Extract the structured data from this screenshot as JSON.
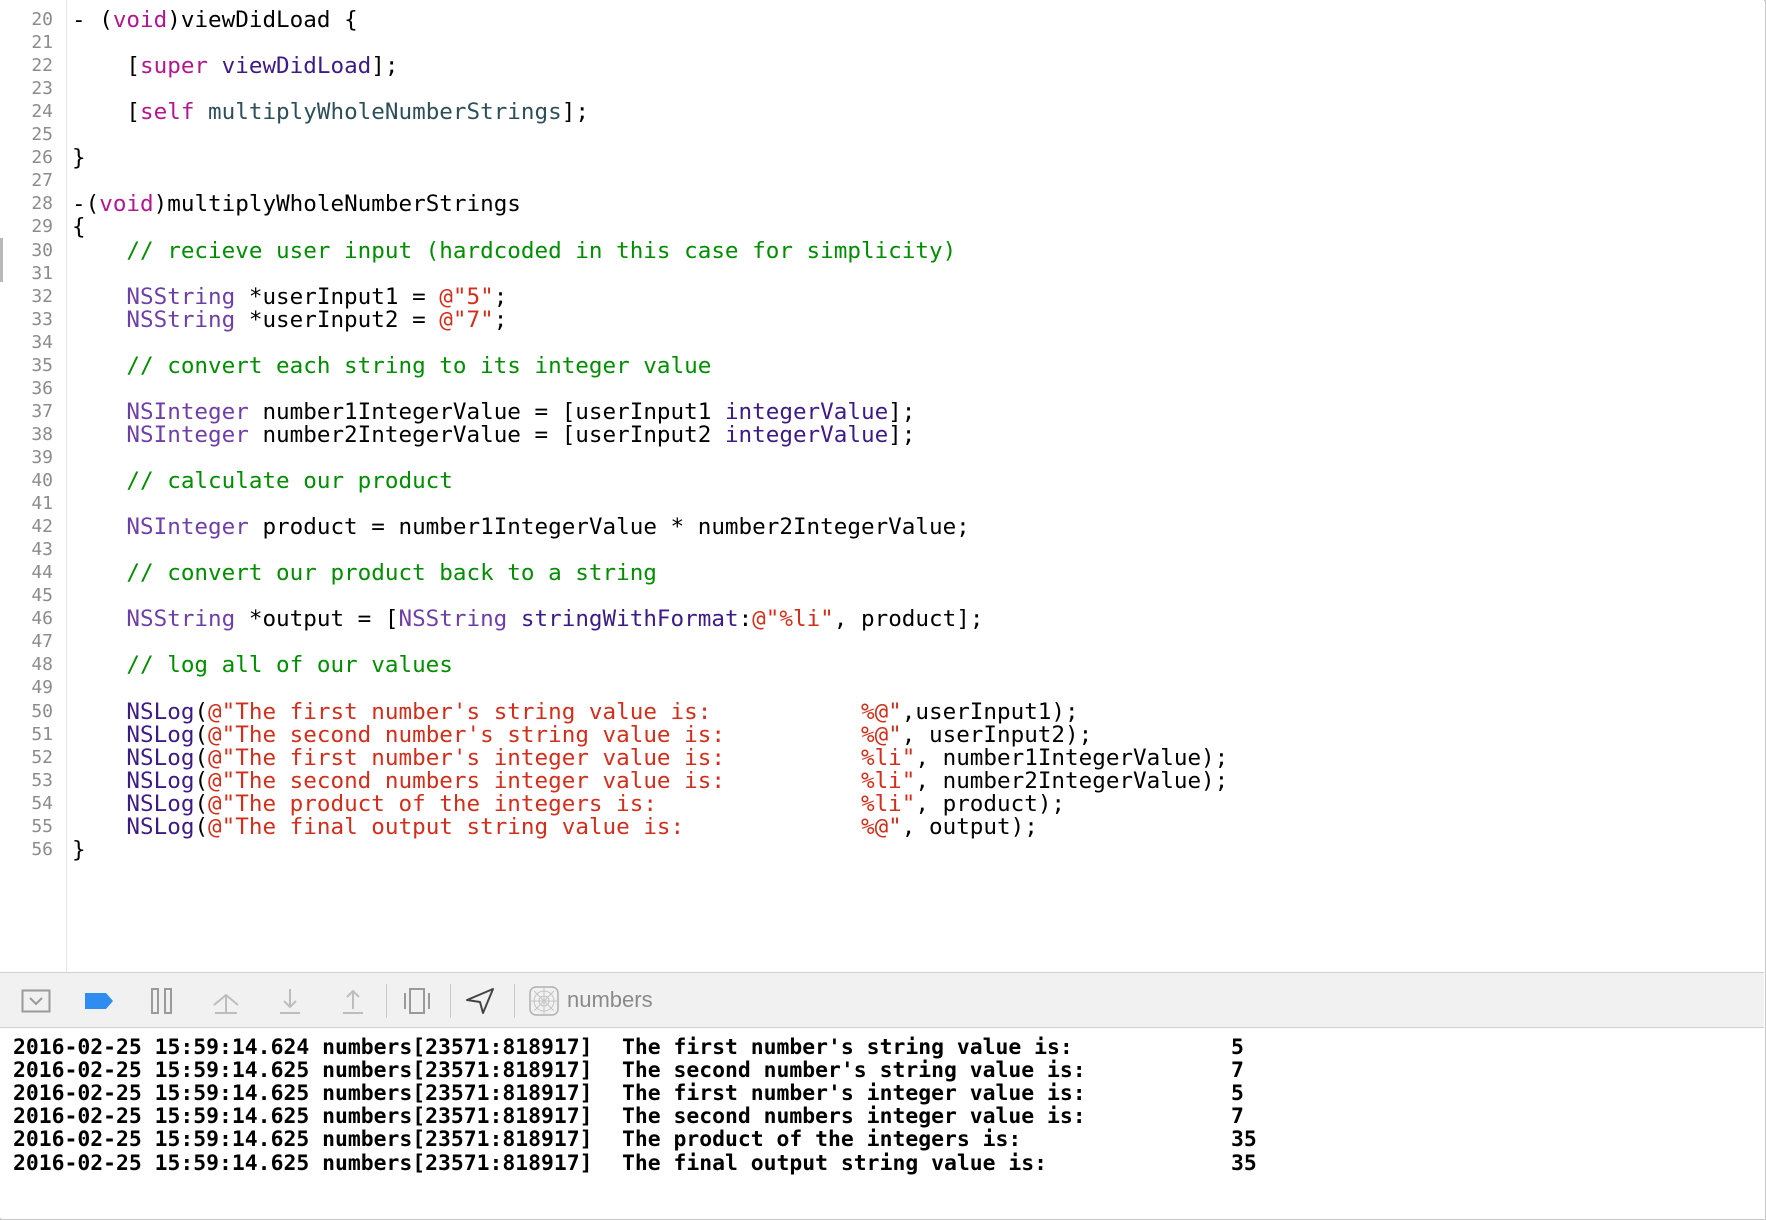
{
  "editor": {
    "lines": [
      {
        "number": "20",
        "tokens": [
          {
            "t": "- (",
            "c": "plain"
          },
          {
            "t": "void",
            "c": "keyword"
          },
          {
            "t": ")viewDidLoad {",
            "c": "plain"
          }
        ]
      },
      {
        "number": "21",
        "tokens": []
      },
      {
        "number": "22",
        "tokens": [
          {
            "t": "    [",
            "c": "plain"
          },
          {
            "t": "super",
            "c": "keyword"
          },
          {
            "t": " ",
            "c": "plain"
          },
          {
            "t": "viewDidLoad",
            "c": "method"
          },
          {
            "t": "];",
            "c": "plain"
          }
        ]
      },
      {
        "number": "23",
        "tokens": []
      },
      {
        "number": "24",
        "tokens": [
          {
            "t": "    [",
            "c": "plain"
          },
          {
            "t": "self",
            "c": "keyword"
          },
          {
            "t": " ",
            "c": "plain"
          },
          {
            "t": "multiplyWholeNumberStrings",
            "c": "member"
          },
          {
            "t": "];",
            "c": "plain"
          }
        ]
      },
      {
        "number": "25",
        "tokens": []
      },
      {
        "number": "26",
        "tokens": [
          {
            "t": "}",
            "c": "plain"
          }
        ]
      },
      {
        "number": "27",
        "tokens": []
      },
      {
        "number": "28",
        "tokens": [
          {
            "t": "-(",
            "c": "plain"
          },
          {
            "t": "void",
            "c": "keyword"
          },
          {
            "t": ")multiplyWholeNumberStrings",
            "c": "plain"
          }
        ]
      },
      {
        "number": "29",
        "tokens": [
          {
            "t": "{",
            "c": "plain"
          }
        ]
      },
      {
        "number": "30",
        "tokens": [
          {
            "t": "    // recieve user input (hardcoded in this case for simplicity)",
            "c": "comment"
          }
        ]
      },
      {
        "number": "31",
        "tokens": []
      },
      {
        "number": "32",
        "tokens": [
          {
            "t": "    NSString",
            "c": "type"
          },
          {
            "t": " *userInput1 = ",
            "c": "plain"
          },
          {
            "t": "@\"5\"",
            "c": "string"
          },
          {
            "t": ";",
            "c": "plain"
          }
        ]
      },
      {
        "number": "33",
        "tokens": [
          {
            "t": "    NSString",
            "c": "type"
          },
          {
            "t": " *userInput2 = ",
            "c": "plain"
          },
          {
            "t": "@\"7\"",
            "c": "string"
          },
          {
            "t": ";",
            "c": "plain"
          }
        ]
      },
      {
        "number": "34",
        "tokens": []
      },
      {
        "number": "35",
        "tokens": [
          {
            "t": "    // convert each string to its integer value",
            "c": "comment"
          }
        ]
      },
      {
        "number": "36",
        "tokens": []
      },
      {
        "number": "37",
        "tokens": [
          {
            "t": "    NSInteger",
            "c": "type"
          },
          {
            "t": " number1IntegerValue = [userInput1 ",
            "c": "plain"
          },
          {
            "t": "integerValue",
            "c": "method"
          },
          {
            "t": "];",
            "c": "plain"
          }
        ]
      },
      {
        "number": "38",
        "tokens": [
          {
            "t": "    NSInteger",
            "c": "type"
          },
          {
            "t": " number2IntegerValue = [userInput2 ",
            "c": "plain"
          },
          {
            "t": "integerValue",
            "c": "method"
          },
          {
            "t": "];",
            "c": "plain"
          }
        ]
      },
      {
        "number": "39",
        "tokens": []
      },
      {
        "number": "40",
        "tokens": [
          {
            "t": "    // calculate our product",
            "c": "comment"
          }
        ]
      },
      {
        "number": "41",
        "tokens": []
      },
      {
        "number": "42",
        "tokens": [
          {
            "t": "    NSInteger",
            "c": "type"
          },
          {
            "t": " product = number1IntegerValue * number2IntegerValue;",
            "c": "plain"
          }
        ]
      },
      {
        "number": "43",
        "tokens": []
      },
      {
        "number": "44",
        "tokens": [
          {
            "t": "    // convert our product back to a string",
            "c": "comment"
          }
        ]
      },
      {
        "number": "45",
        "tokens": []
      },
      {
        "number": "46",
        "tokens": [
          {
            "t": "    NSString",
            "c": "type"
          },
          {
            "t": " *output = [",
            "c": "plain"
          },
          {
            "t": "NSString",
            "c": "type"
          },
          {
            "t": " ",
            "c": "plain"
          },
          {
            "t": "stringWithFormat",
            "c": "method"
          },
          {
            "t": ":",
            "c": "plain"
          },
          {
            "t": "@\"%li\"",
            "c": "string"
          },
          {
            "t": ", product];",
            "c": "plain"
          }
        ]
      },
      {
        "number": "47",
        "tokens": []
      },
      {
        "number": "48",
        "tokens": [
          {
            "t": "    // log all of our values",
            "c": "comment"
          }
        ]
      },
      {
        "number": "49",
        "tokens": []
      },
      {
        "number": "50",
        "tokens": [
          {
            "t": "    NSLog",
            "c": "method"
          },
          {
            "t": "(",
            "c": "plain"
          },
          {
            "t": "@\"The first number's string value is:           %@\"",
            "c": "string"
          },
          {
            "t": ",userInput1);",
            "c": "plain"
          }
        ]
      },
      {
        "number": "51",
        "tokens": [
          {
            "t": "    NSLog",
            "c": "method"
          },
          {
            "t": "(",
            "c": "plain"
          },
          {
            "t": "@\"The second number's string value is:          %@\"",
            "c": "string"
          },
          {
            "t": ", userInput2);",
            "c": "plain"
          }
        ]
      },
      {
        "number": "52",
        "tokens": [
          {
            "t": "    NSLog",
            "c": "method"
          },
          {
            "t": "(",
            "c": "plain"
          },
          {
            "t": "@\"The first number's integer value is:          %li\"",
            "c": "string"
          },
          {
            "t": ", number1IntegerValue);",
            "c": "plain"
          }
        ]
      },
      {
        "number": "53",
        "tokens": [
          {
            "t": "    NSLog",
            "c": "method"
          },
          {
            "t": "(",
            "c": "plain"
          },
          {
            "t": "@\"The second numbers integer value is:          %li\"",
            "c": "string"
          },
          {
            "t": ", number2IntegerValue);",
            "c": "plain"
          }
        ]
      },
      {
        "number": "54",
        "tokens": [
          {
            "t": "    NSLog",
            "c": "method"
          },
          {
            "t": "(",
            "c": "plain"
          },
          {
            "t": "@\"The product of the integers is:               %li\"",
            "c": "string"
          },
          {
            "t": ", product);",
            "c": "plain"
          }
        ]
      },
      {
        "number": "55",
        "tokens": [
          {
            "t": "    NSLog",
            "c": "method"
          },
          {
            "t": "(",
            "c": "plain"
          },
          {
            "t": "@\"The final output string value is:             %@\"",
            "c": "string"
          },
          {
            "t": ", output);",
            "c": "plain"
          }
        ]
      },
      {
        "number": "56",
        "tokens": [
          {
            "t": "}",
            "c": "plain"
          }
        ]
      }
    ]
  },
  "debug_bar": {
    "buttons": [
      {
        "name": "hide-debug-area-button",
        "icon": "hide-debug-area-icon"
      },
      {
        "name": "breakpoints-toggle-button",
        "icon": "breakpoint-icon"
      },
      {
        "name": "pause-continue-button",
        "icon": "pause-icon"
      },
      {
        "name": "step-over-button",
        "icon": "step-over-icon"
      },
      {
        "name": "step-into-button",
        "icon": "step-into-icon"
      },
      {
        "name": "step-out-button",
        "icon": "step-out-icon"
      },
      {
        "name": "debug-view-hierarchy-button",
        "icon": "view-hierarchy-icon"
      },
      {
        "name": "simulate-location-button",
        "icon": "location-arrow-icon"
      }
    ],
    "target_icon": "app-target-icon",
    "target_name": "numbers",
    "colors": {
      "breakpoint_active": "#2f8cf0",
      "icon": "#9a9a9a"
    }
  },
  "console": {
    "lines": [
      {
        "prefix": "2016-02-25 15:59:14.624 numbers[23571:818917]",
        "message": "The first number's string value is:",
        "value": "5"
      },
      {
        "prefix": "2016-02-25 15:59:14.625 numbers[23571:818917]",
        "message": "The second number's string value is:",
        "value": "7"
      },
      {
        "prefix": "2016-02-25 15:59:14.625 numbers[23571:818917]",
        "message": "The first number's integer value is:",
        "value": "5"
      },
      {
        "prefix": "2016-02-25 15:59:14.625 numbers[23571:818917]",
        "message": "The second numbers integer value is:",
        "value": "7"
      },
      {
        "prefix": "2016-02-25 15:59:14.625 numbers[23571:818917]",
        "message": "The product of the integers is:",
        "value": "35"
      },
      {
        "prefix": "2016-02-25 15:59:14.625 numbers[23571:818917]",
        "message": "The final output string value is:",
        "value": "35"
      }
    ]
  }
}
